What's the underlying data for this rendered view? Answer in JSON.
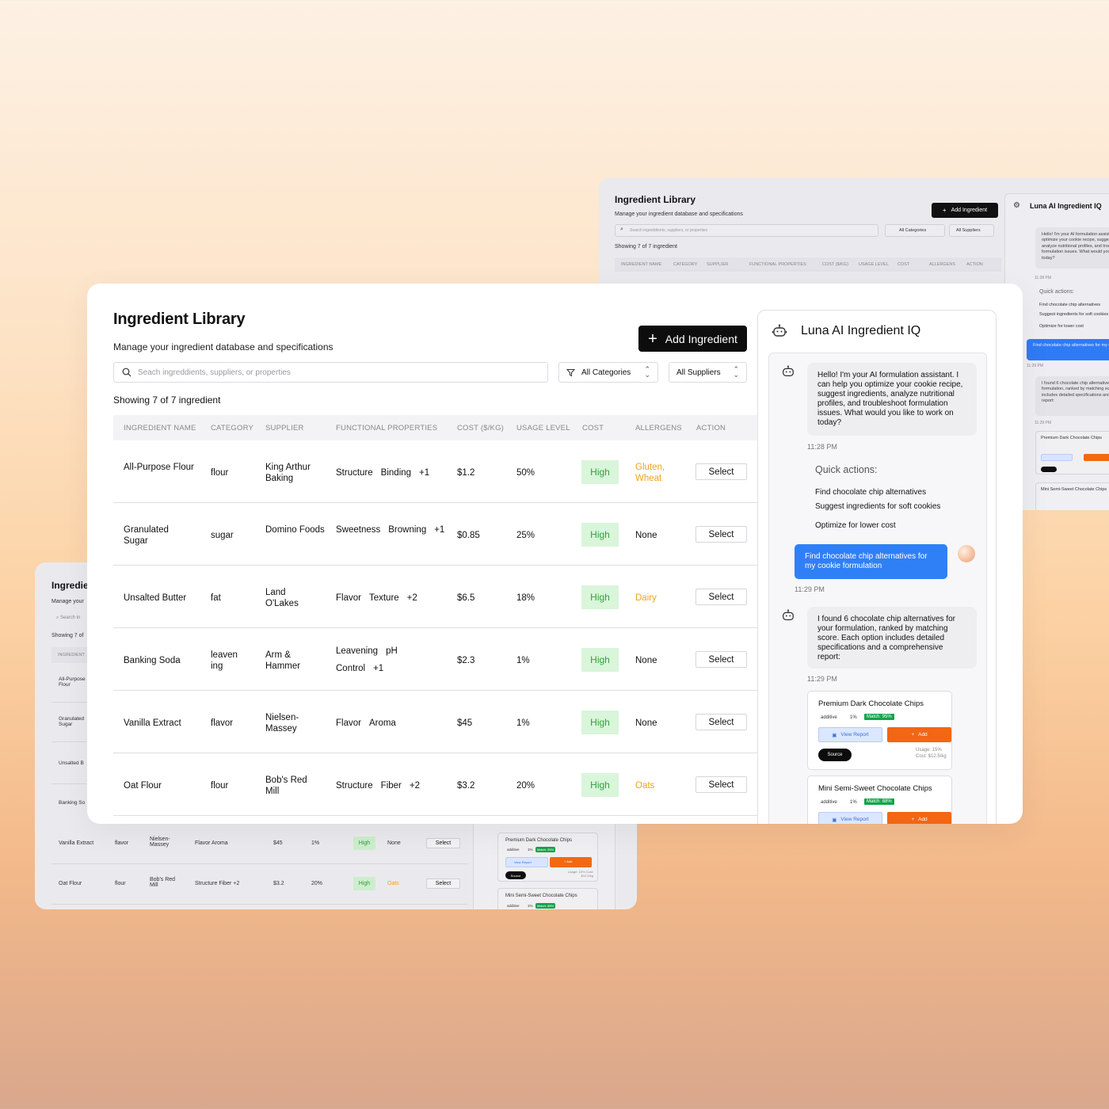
{
  "app": {
    "title": "Ingredient Library",
    "subtitle": "Manage your ingredient database and specifications",
    "add_button": "Add Ingredient",
    "search_placeholder": "Seach ingreddients, suppliers, or properties",
    "search_placeholder_back": "Search ingreddients, suppliers, or properties",
    "filter_categories": "All Categories",
    "filter_suppliers": "All Suppliers",
    "showing": "Showing 7 of 7 ingredient"
  },
  "table": {
    "headers": [
      "INGREDIENT NAME",
      "CATEGORY",
      "SUPPLIER",
      "FUNCTIONAL  PROPERTIES",
      "COST ($/KG)",
      "USAGE LEVEL",
      "COST",
      "ALLERGENS",
      "ACTION"
    ],
    "rows": [
      {
        "name": "All-Purpose Flour",
        "category": "flour",
        "supplier": "King Arthur Baking",
        "props": [
          "Structure",
          "Binding"
        ],
        "more": "+1",
        "cost": "$1.2",
        "usage": "50%",
        "cost_level": "High",
        "allergens": "Gluten, Wheat",
        "allergen_warn": true,
        "action": "Select"
      },
      {
        "name": "Granulated Sugar",
        "category": "sugar",
        "supplier": "Domino Foods",
        "props": [
          "Sweetness",
          "Browning"
        ],
        "more": "+1",
        "cost": "$0.85",
        "usage": "25%",
        "cost_level": "High",
        "allergens": "None",
        "allergen_warn": false,
        "action": "Select"
      },
      {
        "name": "Unsalted Butter",
        "category": "fat",
        "supplier": "Land O'Lakes",
        "props": [
          "Flavor",
          "Texture"
        ],
        "more": "+2",
        "cost": "$6.5",
        "usage": "18%",
        "cost_level": "High",
        "allergens": "Dairy",
        "allergen_warn": true,
        "action": "Select"
      },
      {
        "name": "Banking Soda",
        "category": "leaven ing",
        "supplier": "Arm & Hammer",
        "props": [
          "Leavening",
          "pH Control"
        ],
        "more": "+1",
        "cost": "$2.3",
        "usage": "1%",
        "cost_level": "High",
        "allergens": "None",
        "allergen_warn": false,
        "action": "Select"
      },
      {
        "name": "Vanilla Extract",
        "category": "flavor",
        "supplier": "Nielsen-Massey",
        "props": [
          "Flavor",
          "Aroma"
        ],
        "more": "",
        "cost": "$45",
        "usage": "1%",
        "cost_level": "High",
        "allergens": "None",
        "allergen_warn": false,
        "action": "Select"
      },
      {
        "name": "Oat Flour",
        "category": "flour",
        "supplier": "Bob's Red Mill",
        "props": [
          "Structure",
          "Fiber"
        ],
        "more": "+2",
        "cost": "$3.2",
        "usage": "20%",
        "cost_level": "High",
        "allergens": "Oats",
        "allergen_warn": true,
        "action": "Select"
      }
    ]
  },
  "chat": {
    "title": "Luna AI Ingredient IQ",
    "greeting": "Hello! I'm your AI formulation assistant. I can help you optimize your cookie recipe, suggest ingredients, analyze nutritional profiles, and troubleshoot formulation issues. What would you like to work on today?",
    "greeting_back": "Hello! I'm your AI formulation assistant. I can help you optimize your cookie recipe, suggest ingredients, analyze nutritional profiles, and troubleshoot formulation issues. What would you like to work on today?",
    "time1": "11:28 PM",
    "quick_title": "Quick actions:",
    "quick_actions": [
      "Find chocolate chip alternatives",
      "Suggest ingredients for soft cookies",
      "Optimize for lower cost"
    ],
    "user_msg": "Find chocolate chip alternatives for my cookie formulation",
    "time2": "11:29 PM",
    "reply": "I found 6 chocolate chip alternatives for your formulation, ranked by matching score. Each option includes detailed specifications and a comprehensive report:",
    "time3": "11:29 PM",
    "results": [
      {
        "name": "Premium Dark Chocolate Chips",
        "type": "additive",
        "pct": "1%",
        "match": "Match: 95%",
        "view": "View Report",
        "add": "Add",
        "source": "Source",
        "usage": "Usage: 15%",
        "cost": "Cost: $12.5/kg"
      },
      {
        "name": "Mini Semi-Sweet Chocolate Chips",
        "type": "additive",
        "pct": "1%",
        "match": "Match: 88%",
        "view": "View Report",
        "add": "Add"
      }
    ]
  },
  "back_left": {
    "title": "Ingredie",
    "sub": "Manage your",
    "search": "Search in",
    "showing": "Showing 7 of",
    "header": "INGREDIENT",
    "names": [
      "All-Purpose Flour",
      "Granulated Sugar",
      "Unsalted B",
      "Banking So"
    ],
    "rows": [
      {
        "name": "Vanilla Extract",
        "category": "flavor",
        "supplier": "Nielsen-Massey",
        "props": "Flavor   Aroma",
        "cost": "$45",
        "usage": "1%",
        "level": "High",
        "allergens": "None",
        "action": "Select"
      },
      {
        "name": "Oat Flour",
        "category": "flour",
        "supplier": "Bob's Red Mill",
        "props": "Structure   Fiber   +2",
        "cost": "$3.2",
        "usage": "20%",
        "level": "High",
        "allergens": "Oats",
        "action": "Select"
      }
    ],
    "card1": "Premium Dark Chocolate Chips",
    "card2": "Mini Semi-Sweet Chocolate Chips",
    "card_type": "additive",
    "card_pct": "1%",
    "card_match1": "Match: 95%",
    "card_match2": "Match: 88%",
    "card_view": "View Report",
    "card_add": "+ Add",
    "card_source": "Source",
    "card_usage": "Usage: 15% Cost: $12.5/kg"
  },
  "colors": {
    "accent_blue": "#2f80f6",
    "orange": "#f26614",
    "green": "#16a34a",
    "high_bg": "#d9f5da",
    "warn": "#f0a21a"
  }
}
